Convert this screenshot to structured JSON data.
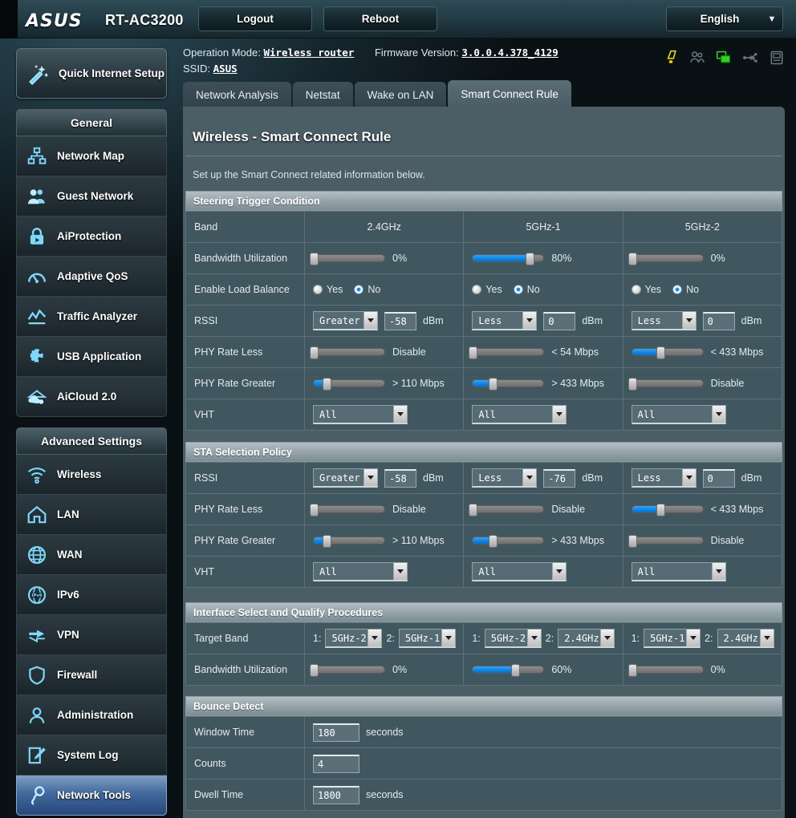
{
  "brand": {
    "logo": "ASUS",
    "model": "RT-AC3200"
  },
  "topbar": {
    "logout_label": "Logout",
    "reboot_label": "Reboot",
    "language": "English",
    "caret_icon": "chevron-down-icon"
  },
  "info": {
    "operation_mode_label": "Operation Mode:",
    "operation_mode_value": "Wireless router",
    "firmware_label": "Firmware Version:",
    "firmware_value": "3.0.0.4.378_4129",
    "ssid_label": "SSID:",
    "ssid_value": "ASUS"
  },
  "status_icons": [
    {
      "name": "warning-icon",
      "color": "#e8d118"
    },
    {
      "name": "guest-users-icon",
      "color": "#6e7a80"
    },
    {
      "name": "network-clients-icon",
      "color": "#2fd321"
    },
    {
      "name": "usb-icon",
      "color": "#6e7a80"
    },
    {
      "name": "printer-icon",
      "color": "#6e7a80"
    }
  ],
  "sidebar": {
    "quick_setup_label": "Quick Internet Setup",
    "quick_setup_icon": "magic-wand-icon",
    "groups": [
      {
        "title": "General",
        "items": [
          {
            "label": "Network Map",
            "icon": "network-map-icon",
            "active": false
          },
          {
            "label": "Guest Network",
            "icon": "guest-network-icon",
            "active": false
          },
          {
            "label": "AiProtection",
            "icon": "lock-icon",
            "active": false
          },
          {
            "label": "Adaptive QoS",
            "icon": "gauge-icon",
            "active": false
          },
          {
            "label": "Traffic Analyzer",
            "icon": "chart-icon",
            "active": false
          },
          {
            "label": "USB Application",
            "icon": "puzzle-icon",
            "active": false
          },
          {
            "label": "AiCloud 2.0",
            "icon": "cloud-icon",
            "active": false
          }
        ]
      },
      {
        "title": "Advanced Settings",
        "items": [
          {
            "label": "Wireless",
            "icon": "wifi-icon",
            "active": false
          },
          {
            "label": "LAN",
            "icon": "home-icon",
            "active": false
          },
          {
            "label": "WAN",
            "icon": "globe-icon",
            "active": false
          },
          {
            "label": "IPv6",
            "icon": "ipv6-icon",
            "active": false
          },
          {
            "label": "VPN",
            "icon": "vpn-arrows-icon",
            "active": false
          },
          {
            "label": "Firewall",
            "icon": "shield-icon",
            "active": false
          },
          {
            "label": "Administration",
            "icon": "person-icon",
            "active": false
          },
          {
            "label": "System Log",
            "icon": "notepad-icon",
            "active": false
          },
          {
            "label": "Network Tools",
            "icon": "wrench-icon",
            "active": true
          }
        ]
      }
    ]
  },
  "tabs": [
    {
      "label": "Network Analysis",
      "active": false
    },
    {
      "label": "Netstat",
      "active": false
    },
    {
      "label": "Wake on LAN",
      "active": false
    },
    {
      "label": "Smart Connect Rule",
      "active": true
    }
  ],
  "page": {
    "title": "Wireless - Smart Connect Rule",
    "description": "Set up the Smart Connect related information below."
  },
  "sections": {
    "steering": {
      "heading": "Steering Trigger Condition",
      "rows": {
        "band": {
          "label": "Band",
          "values": [
            "2.4GHz",
            "5GHz-1",
            "5GHz-2"
          ]
        },
        "bandwidth": {
          "label": "Bandwidth Utilization",
          "values": [
            {
              "percent": 0,
              "text": "0%"
            },
            {
              "percent": 80,
              "text": "80%"
            },
            {
              "percent": 0,
              "text": "0%"
            }
          ]
        },
        "loadbal": {
          "label": "Enable Load Balance",
          "yes_label": "Yes",
          "no_label": "No",
          "values": [
            "No",
            "No",
            "No"
          ]
        },
        "rssi": {
          "label": "RSSI",
          "unit": "dBm",
          "values": [
            {
              "op": "Greater",
              "num": "-58"
            },
            {
              "op": "Less",
              "num": "0"
            },
            {
              "op": "Less",
              "num": "0"
            }
          ]
        },
        "phy_less": {
          "label": "PHY Rate Less",
          "values": [
            {
              "percent": 0,
              "text": "Disable"
            },
            {
              "percent": 0,
              "text": "< 54 Mbps"
            },
            {
              "percent": 40,
              "text": "< 433 Mbps"
            }
          ]
        },
        "phy_greater": {
          "label": "PHY Rate Greater",
          "values": [
            {
              "percent": 18,
              "text": "> 110 Mbps"
            },
            {
              "percent": 28,
              "text": "> 433 Mbps"
            },
            {
              "percent": 0,
              "text": "Disable"
            }
          ]
        },
        "vht": {
          "label": "VHT",
          "values": [
            "All",
            "All",
            "All"
          ]
        }
      }
    },
    "sta": {
      "heading": "STA Selection Policy",
      "rows": {
        "rssi": {
          "label": "RSSI",
          "unit": "dBm",
          "values": [
            {
              "op": "Greater",
              "num": "-58"
            },
            {
              "op": "Less",
              "num": "-76"
            },
            {
              "op": "Less",
              "num": "0"
            }
          ]
        },
        "phy_less": {
          "label": "PHY Rate Less",
          "values": [
            {
              "percent": 0,
              "text": "Disable"
            },
            {
              "percent": 0,
              "text": "Disable"
            },
            {
              "percent": 40,
              "text": "< 433 Mbps"
            }
          ]
        },
        "phy_greater": {
          "label": "PHY Rate Greater",
          "values": [
            {
              "percent": 18,
              "text": "> 110 Mbps"
            },
            {
              "percent": 28,
              "text": "> 433 Mbps"
            },
            {
              "percent": 0,
              "text": "Disable"
            }
          ]
        },
        "vht": {
          "label": "VHT",
          "values": [
            "All",
            "All",
            "All"
          ]
        }
      }
    },
    "interface": {
      "heading": "Interface Select and Qualify Procedures",
      "rows": {
        "target": {
          "label": "Target Band",
          "n1": "1:",
          "n2": "2:",
          "values": [
            {
              "first": "5GHz-2",
              "second": "5GHz-1"
            },
            {
              "first": "5GHz-2",
              "second": "2.4GHz"
            },
            {
              "first": "5GHz-1",
              "second": "2.4GHz"
            }
          ]
        },
        "bandwidth": {
          "label": "Bandwidth Utilization",
          "values": [
            {
              "percent": 0,
              "text": "0%"
            },
            {
              "percent": 60,
              "text": "60%"
            },
            {
              "percent": 0,
              "text": "0%"
            }
          ]
        }
      }
    },
    "bounce": {
      "heading": "Bounce Detect",
      "rows": [
        {
          "label": "Window Time",
          "value": "180",
          "unit": "seconds"
        },
        {
          "label": "Counts",
          "value": "4",
          "unit": ""
        },
        {
          "label": "Dwell Time",
          "value": "1800",
          "unit": "seconds"
        }
      ]
    }
  },
  "colors": {
    "accent_blue": "#0d86e8",
    "panel_bg": "#4b5d65",
    "cell_bg": "#415760",
    "active_menu": "#43699c"
  }
}
